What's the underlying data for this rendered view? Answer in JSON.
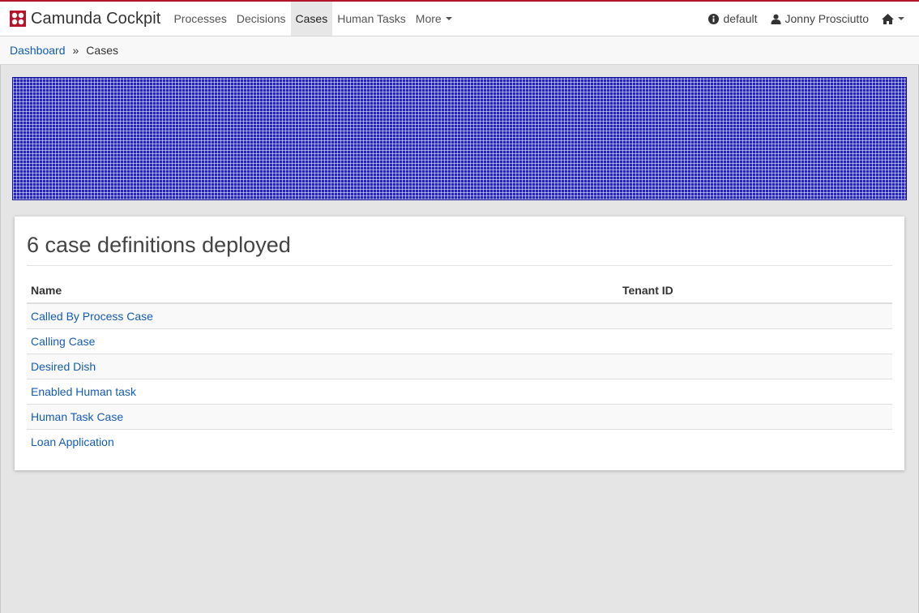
{
  "header": {
    "brand": "Camunda Cockpit",
    "nav": [
      {
        "label": "Processes",
        "active": false
      },
      {
        "label": "Decisions",
        "active": false
      },
      {
        "label": "Cases",
        "active": true
      },
      {
        "label": "Human Tasks",
        "active": false
      },
      {
        "label": "More",
        "active": false
      }
    ],
    "engine_label": "default",
    "user_label": "Jonny Prosciutto",
    "icons": {
      "engine": "info-icon",
      "user": "user-icon",
      "home": "home-icon"
    }
  },
  "breadcrumb": {
    "root": "Dashboard",
    "separator": "»",
    "current": "Cases"
  },
  "main": {
    "title": "6 case definitions deployed",
    "columns": [
      "Name",
      "Tenant ID"
    ],
    "rows": [
      {
        "name": "Called By Process Case",
        "tenant": ""
      },
      {
        "name": "Calling Case",
        "tenant": ""
      },
      {
        "name": "Desired Dish",
        "tenant": ""
      },
      {
        "name": "Enabled Human task",
        "tenant": ""
      },
      {
        "name": "Human Task Case",
        "tenant": ""
      },
      {
        "name": "Loan Application",
        "tenant": ""
      }
    ]
  },
  "colors": {
    "brand_red": "#b5152b",
    "link_blue": "#155cb5",
    "pattern_blue": "#2424c8"
  }
}
